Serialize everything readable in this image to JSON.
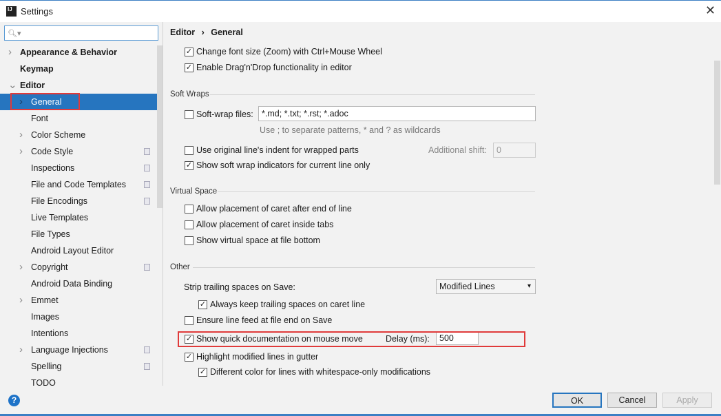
{
  "window": {
    "title": "Settings",
    "close_icon": "close-icon"
  },
  "search": {
    "placeholder": ""
  },
  "sidebar": {
    "items": [
      {
        "label": "Appearance & Behavior",
        "bold": true,
        "arrow": "right",
        "level": 0
      },
      {
        "label": "Keymap",
        "bold": true,
        "level": 0
      },
      {
        "label": "Editor",
        "bold": true,
        "arrow": "down",
        "level": 0
      },
      {
        "label": "General",
        "arrow": "right",
        "level": 1,
        "selected": true
      },
      {
        "label": "Font",
        "level": 1
      },
      {
        "label": "Color Scheme",
        "arrow": "right",
        "level": 1
      },
      {
        "label": "Code Style",
        "arrow": "right",
        "level": 1,
        "copy": true
      },
      {
        "label": "Inspections",
        "level": 1,
        "copy": true
      },
      {
        "label": "File and Code Templates",
        "level": 1,
        "copy": true
      },
      {
        "label": "File Encodings",
        "level": 1,
        "copy": true
      },
      {
        "label": "Live Templates",
        "level": 1
      },
      {
        "label": "File Types",
        "level": 1
      },
      {
        "label": "Android Layout Editor",
        "level": 1
      },
      {
        "label": "Copyright",
        "arrow": "right",
        "level": 1,
        "copy": true
      },
      {
        "label": "Android Data Binding",
        "level": 1
      },
      {
        "label": "Emmet",
        "arrow": "right",
        "level": 1
      },
      {
        "label": "Images",
        "level": 1
      },
      {
        "label": "Intentions",
        "level": 1
      },
      {
        "label": "Language Injections",
        "arrow": "right",
        "level": 1,
        "copy": true
      },
      {
        "label": "Spelling",
        "level": 1,
        "copy": true
      },
      {
        "label": "TODO",
        "level": 1
      }
    ]
  },
  "breadcrumb": {
    "parent": "Editor",
    "sep": "›",
    "current": "General"
  },
  "main": {
    "zoom_label": "Change font size (Zoom) with Ctrl+Mouse Wheel",
    "zoom_checked": true,
    "dnd_label": "Enable Drag'n'Drop functionality in editor",
    "dnd_checked": true,
    "soft_wraps": {
      "title": "Soft Wraps",
      "files_label": "Soft-wrap files:",
      "files_checked": false,
      "files_value": "*.md; *.txt; *.rst; *.adoc",
      "hint": "Use ; to separate patterns, * and ? as wildcards",
      "indent_label": "Use original line's indent for wrapped parts",
      "indent_checked": false,
      "shift_label": "Additional shift:",
      "shift_value": "0",
      "indicators_label": "Show soft wrap indicators for current line only",
      "indicators_checked": true
    },
    "virtual_space": {
      "title": "Virtual Space",
      "items": [
        {
          "label": "Allow placement of caret after end of line",
          "checked": false
        },
        {
          "label": "Allow placement of caret inside tabs",
          "checked": false
        },
        {
          "label": "Show virtual space at file bottom",
          "checked": false
        }
      ]
    },
    "other": {
      "title": "Other",
      "strip_label": "Strip trailing spaces on Save:",
      "strip_value": "Modified Lines",
      "keep_label": "Always keep trailing spaces on caret line",
      "keep_checked": true,
      "ensure_label": "Ensure line feed at file end on Save",
      "ensure_checked": false,
      "quickdoc_label": "Show quick documentation on mouse move",
      "quickdoc_checked": true,
      "delay_label": "Delay (ms):",
      "delay_value": "500",
      "highlight_label": "Highlight modified lines in gutter",
      "highlight_checked": true,
      "diffcolor_label": "Different color for lines with whitespace-only modifications",
      "diffcolor_checked": true
    }
  },
  "footer": {
    "help_icon": "help-icon",
    "ok": "OK",
    "cancel": "Cancel",
    "apply": "Apply"
  },
  "colors": {
    "selection": "#2675bf",
    "highlight_box": "#e03a3a"
  }
}
